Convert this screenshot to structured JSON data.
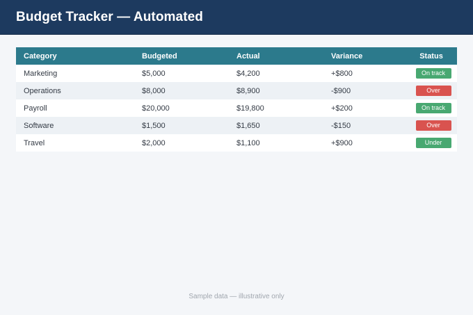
{
  "header": {
    "title": "Budget Tracker — Automated"
  },
  "table": {
    "columns": [
      "Category",
      "Budgeted",
      "Actual",
      "Variance",
      "Status"
    ],
    "rows": [
      {
        "category": "Marketing",
        "budgeted": "$5,000",
        "actual": "$4,200",
        "variance": "+$800",
        "status": "On track",
        "status_color": "#48a871"
      },
      {
        "category": "Operations",
        "budgeted": "$8,000",
        "actual": "$8,900",
        "variance": "-$900",
        "status": "Over",
        "status_color": "#d9534f"
      },
      {
        "category": "Payroll",
        "budgeted": "$20,000",
        "actual": "$19,800",
        "variance": "+$200",
        "status": "On track",
        "status_color": "#48a871"
      },
      {
        "category": "Software",
        "budgeted": "$1,500",
        "actual": "$1,650",
        "variance": "-$150",
        "status": "Over",
        "status_color": "#d9534f"
      },
      {
        "category": "Travel",
        "budgeted": "$2,000",
        "actual": "$1,100",
        "variance": "+$900",
        "status": "Under",
        "status_color": "#48a871"
      }
    ]
  },
  "footer": {
    "note": "Sample data — illustrative only"
  },
  "colors": {
    "header_bg": "#1d3a5f",
    "table_header_bg": "#2c7a8c",
    "badge_green": "#48a871",
    "badge_red": "#d9534f"
  }
}
